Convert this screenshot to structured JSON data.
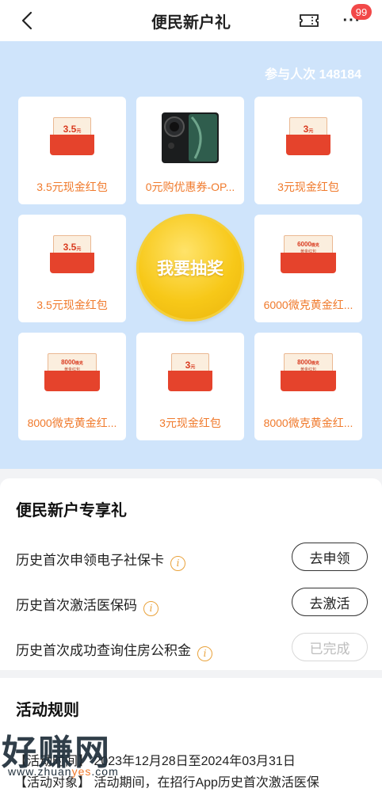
{
  "header": {
    "title": "便民新户礼",
    "badge_count": "99",
    "more_dots": "···"
  },
  "lottery": {
    "participants": "参与人次 148184",
    "draw_button": "我要抽奖",
    "prizes": [
      {
        "label": "3.5元现金红包",
        "kind": "red-packet",
        "amount": "3.5",
        "unit": "元"
      },
      {
        "label": "0元购优惠券-OP...",
        "kind": "phone"
      },
      {
        "label": "3元现金红包",
        "kind": "red-packet",
        "amount": "3",
        "unit": "元"
      },
      {
        "label": "3.5元现金红包",
        "kind": "red-packet",
        "amount": "3.5",
        "unit": "元"
      },
      {
        "label": "6000微克黄金红...",
        "kind": "gold-packet",
        "amount": "6000",
        "unit": "微克"
      },
      {
        "label": "8000微克黄金红...",
        "kind": "gold-packet",
        "amount": "8000",
        "unit": "微克"
      },
      {
        "label": "3元现金红包",
        "kind": "red-packet",
        "amount": "3",
        "unit": "元"
      },
      {
        "label": "8000微克黄金红...",
        "kind": "gold-packet",
        "amount": "8000",
        "unit": "微克"
      }
    ],
    "gold_sub": "黄金红包"
  },
  "gifts": {
    "title": "便民新户专享礼",
    "tasks": [
      {
        "text": "历史首次申领电子社保卡",
        "button": "去申领",
        "done": false
      },
      {
        "text": "历史首次激活医保码",
        "button": "去激活",
        "done": false
      },
      {
        "text": "历史首次成功查询住房公积金",
        "button": "已完成",
        "done": true
      }
    ]
  },
  "rules": {
    "title": "活动规则",
    "line1": "【活动时间】 2023年12月28日至2024年03月31日",
    "line2": "【活动对象】 活动期间，在招行App历史首次激活医保"
  },
  "watermark": {
    "main": "好赚网",
    "url_pre": "www.zhuan",
    "url_hl": "yes",
    "url_post": ".com"
  },
  "colors": {
    "accent_orange": "#f07a2c",
    "lottery_bg": "#cfe4fb",
    "draw_button": "#f7c818",
    "badge": "#f24848"
  }
}
